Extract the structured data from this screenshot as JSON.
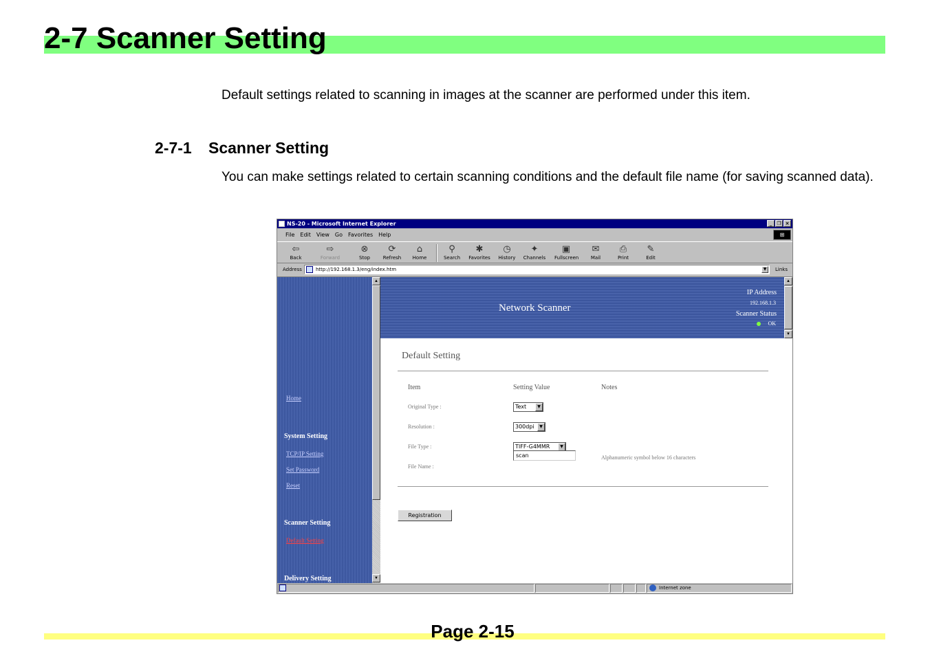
{
  "document": {
    "title": "2-7  Scanner Setting",
    "intro": "Default settings related to scanning in images at the scanner are performed under this item.",
    "subsection_number": "2-7-1",
    "subsection_title": "Scanner Setting",
    "body": "You can make settings related to certain scanning conditions and the default file name (for saving scanned data).",
    "page_label": "Page",
    "page_number": "2-15",
    "colors": {
      "title_band": "#80ff80",
      "footer_band": "#ffff80"
    }
  },
  "browser": {
    "window_title": "NS-20 - Microsoft Internet Explorer",
    "menu": [
      "File",
      "Edit",
      "View",
      "Go",
      "Favorites",
      "Help"
    ],
    "toolbar": [
      {
        "label": "Back",
        "icon": "back-arrow-icon",
        "glyph": "⇦"
      },
      {
        "label": "Forward",
        "icon": "forward-arrow-icon",
        "glyph": "⇨"
      },
      {
        "label": "Stop",
        "icon": "stop-icon",
        "glyph": "⊗"
      },
      {
        "label": "Refresh",
        "icon": "refresh-icon",
        "glyph": "⟳"
      },
      {
        "label": "Home",
        "icon": "home-icon",
        "glyph": "⌂"
      },
      {
        "label": "Search",
        "icon": "search-icon",
        "glyph": "⚲"
      },
      {
        "label": "Favorites",
        "icon": "favorites-icon",
        "glyph": "✱"
      },
      {
        "label": "History",
        "icon": "history-icon",
        "glyph": "◷"
      },
      {
        "label": "Channels",
        "icon": "channels-icon",
        "glyph": "✦"
      },
      {
        "label": "Fullscreen",
        "icon": "fullscreen-icon",
        "glyph": "▣"
      },
      {
        "label": "Mail",
        "icon": "mail-icon",
        "glyph": "✉"
      },
      {
        "label": "Print",
        "icon": "print-icon",
        "glyph": "⎙"
      },
      {
        "label": "Edit",
        "icon": "edit-icon",
        "glyph": "✎"
      }
    ],
    "address_label": "Address",
    "url": "http://192.168.1.3/eng/index.htm",
    "links_label": "Links",
    "status_zone": "Internet zone"
  },
  "sidebar": {
    "home": "Home",
    "system_heading": "System Setting",
    "system_items": [
      "TCP/IP Setting",
      "Set Password",
      "Reset"
    ],
    "scanner_heading": "Scanner Setting",
    "scanner_items": [
      "Default Setting"
    ],
    "delivery_heading": "Delivery Setting"
  },
  "banner": {
    "title": "Network Scanner",
    "ip_label": "IP Address",
    "ip_value": "192.168.1.3",
    "status_label": "Scanner Status",
    "status_value": "OK"
  },
  "form": {
    "heading": "Default Setting",
    "col_item": "Item",
    "col_value": "Setting Value",
    "col_notes": "Notes",
    "original_type_label": "Original Type :",
    "original_type_value": "Text",
    "resolution_label": "Resolution :",
    "resolution_value": "300dpi",
    "file_type_label": "File Type :",
    "file_type_value": "TIFF-G4MMR",
    "file_name_label": "File Name :",
    "file_name_value": "scan",
    "file_name_note": "Alphanumeric symbol below 16 characters",
    "button": "Registration"
  }
}
